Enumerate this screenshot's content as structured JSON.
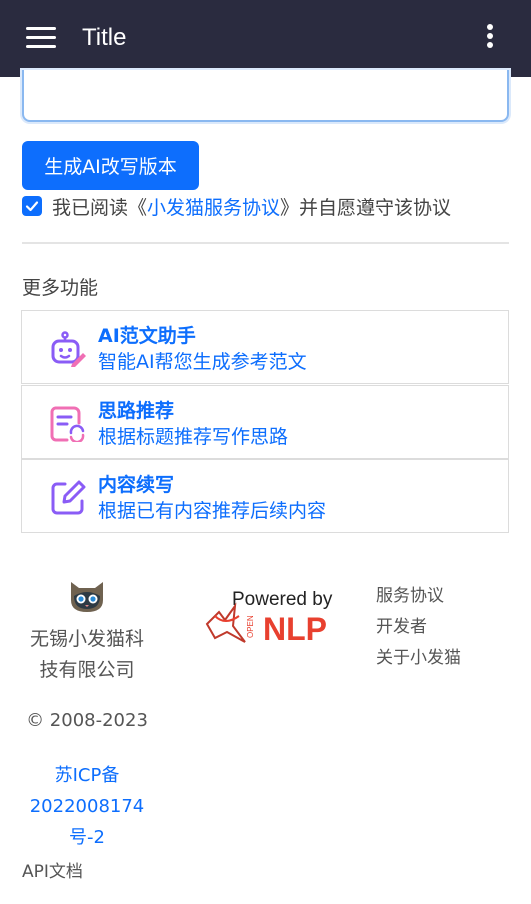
{
  "appbar": {
    "title": "Title",
    "menu_icon": "hamburger-menu-icon",
    "more_icon": "more-vertical-icon",
    "bg_color": "#2a2b3f"
  },
  "editor": {
    "generate_button": "生成AI改写版本",
    "agree_checked": true,
    "agree_prefix": "我已阅读《",
    "agree_link": "小发猫服务协议",
    "agree_suffix": "》并自愿遵守该协议"
  },
  "more": {
    "title": "更多功能",
    "features": [
      {
        "title": "AI范文助手",
        "desc": "智能AI帮您生成参考范文",
        "icon": "robot-pen-icon"
      },
      {
        "title": "思路推荐",
        "desc": "根据标题推荐写作思路",
        "icon": "document-refresh-icon"
      },
      {
        "title": "内容续写",
        "desc": "根据已有内容推荐后续内容",
        "icon": "edit-square-icon"
      }
    ]
  },
  "footer": {
    "logo_icon": "cat-logo-icon",
    "company_line1": "无锡小发猫科",
    "company_line2": "技有限公司",
    "copyright": "© 2008-2023",
    "icp_line1": "苏ICP备",
    "icp_line2": "2022008174",
    "icp_line3": "号-2",
    "api_doc": "API文档",
    "powered_by": "Powered by",
    "powered_open": "OPEN",
    "powered_nlp": "NLP",
    "links": [
      "服务协议",
      "开发者",
      "关于小发猫"
    ]
  },
  "colors": {
    "primary": "#0d6efd",
    "purple_icon": "#8a5cf6",
    "pink_icon": "#f06fb4",
    "nlp_red": "#e8402f"
  }
}
